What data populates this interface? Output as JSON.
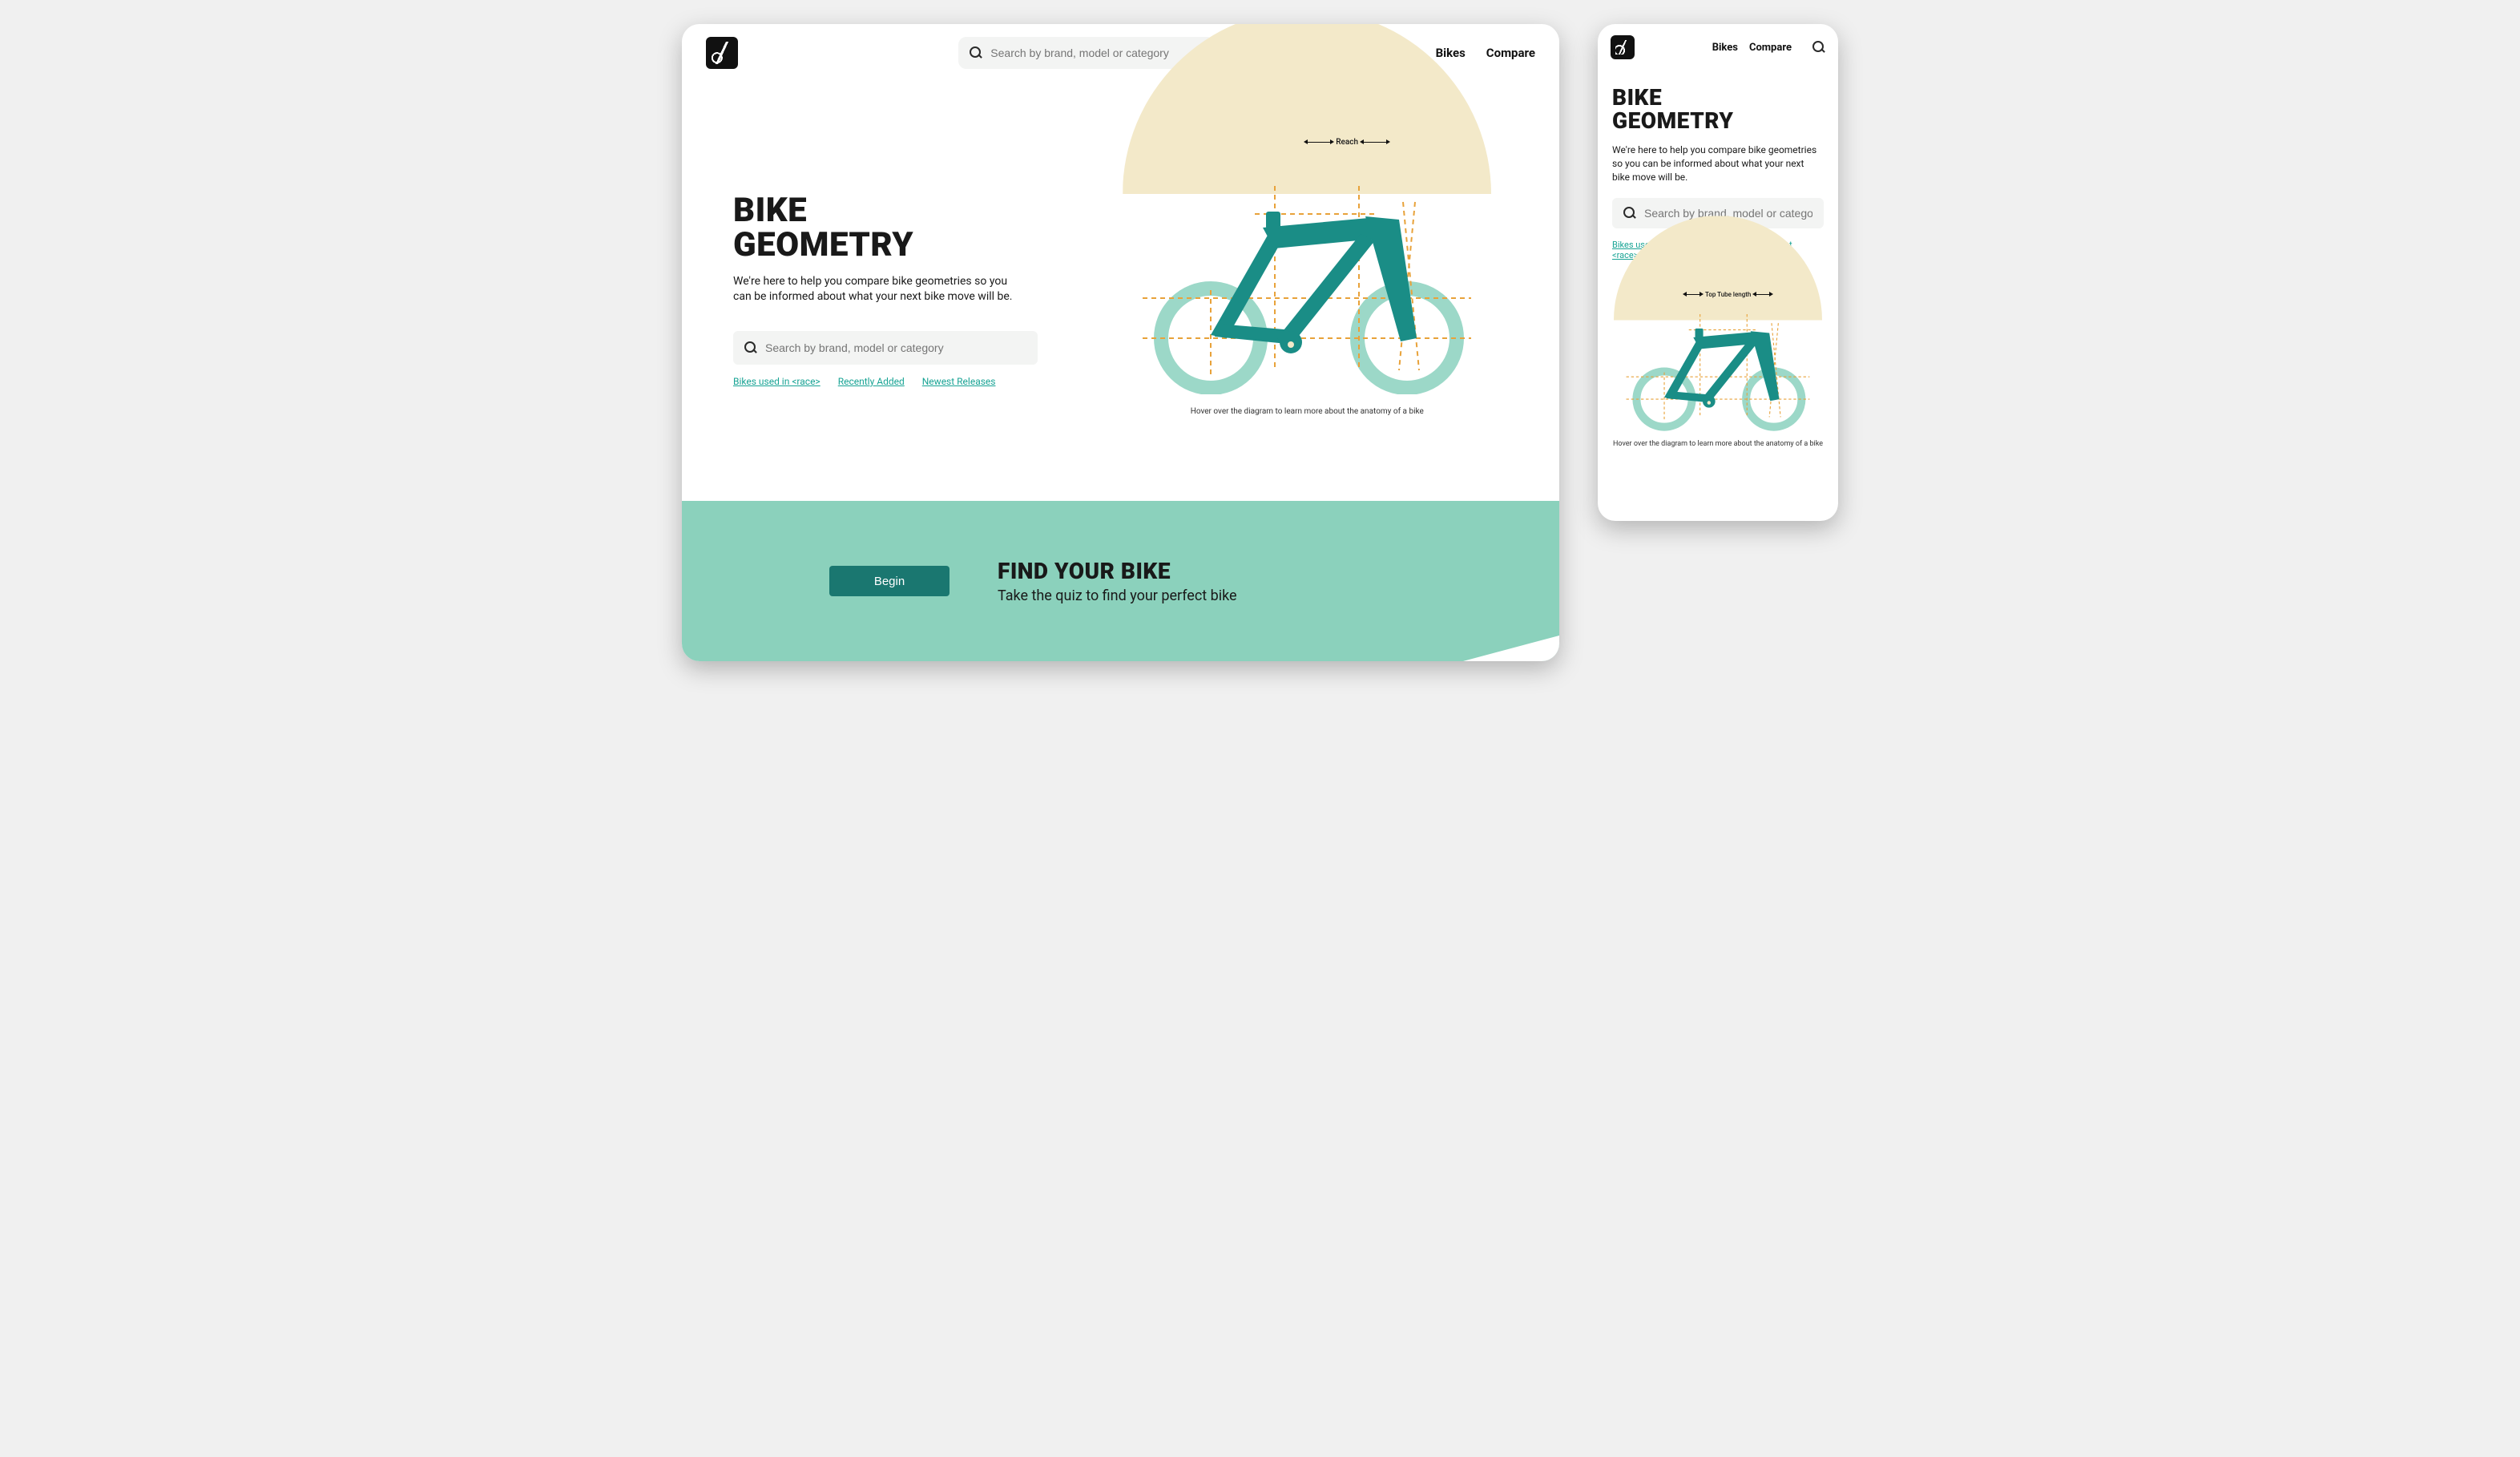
{
  "nav": {
    "bikes": "Bikes",
    "compare": "Compare"
  },
  "search": {
    "placeholder": "Search by brand, model or category"
  },
  "hero": {
    "title_l1": "BIKE",
    "title_l2": "GEOMETRY",
    "subtitle": "We're here to help you compare bike geometries so you can be informed about what your next bike move will be."
  },
  "quicklinks": {
    "a": "Bikes used in <race>",
    "b": "Recently Added",
    "c": "Newest Releases"
  },
  "diagram": {
    "desktop_metric": "Reach",
    "mobile_metric": "Top Tube length",
    "caption": "Hover over the diagram to learn more about the anatomy of a bike"
  },
  "cta": {
    "button": "Begin",
    "title": "FIND YOUR BIKE",
    "subtitle": "Take the quiz to find your perfect bike"
  },
  "colors": {
    "teal": "#1a8d86",
    "mint": "#8bd1bc",
    "cream": "#f3e9c9",
    "guide": "#e8a23a"
  }
}
